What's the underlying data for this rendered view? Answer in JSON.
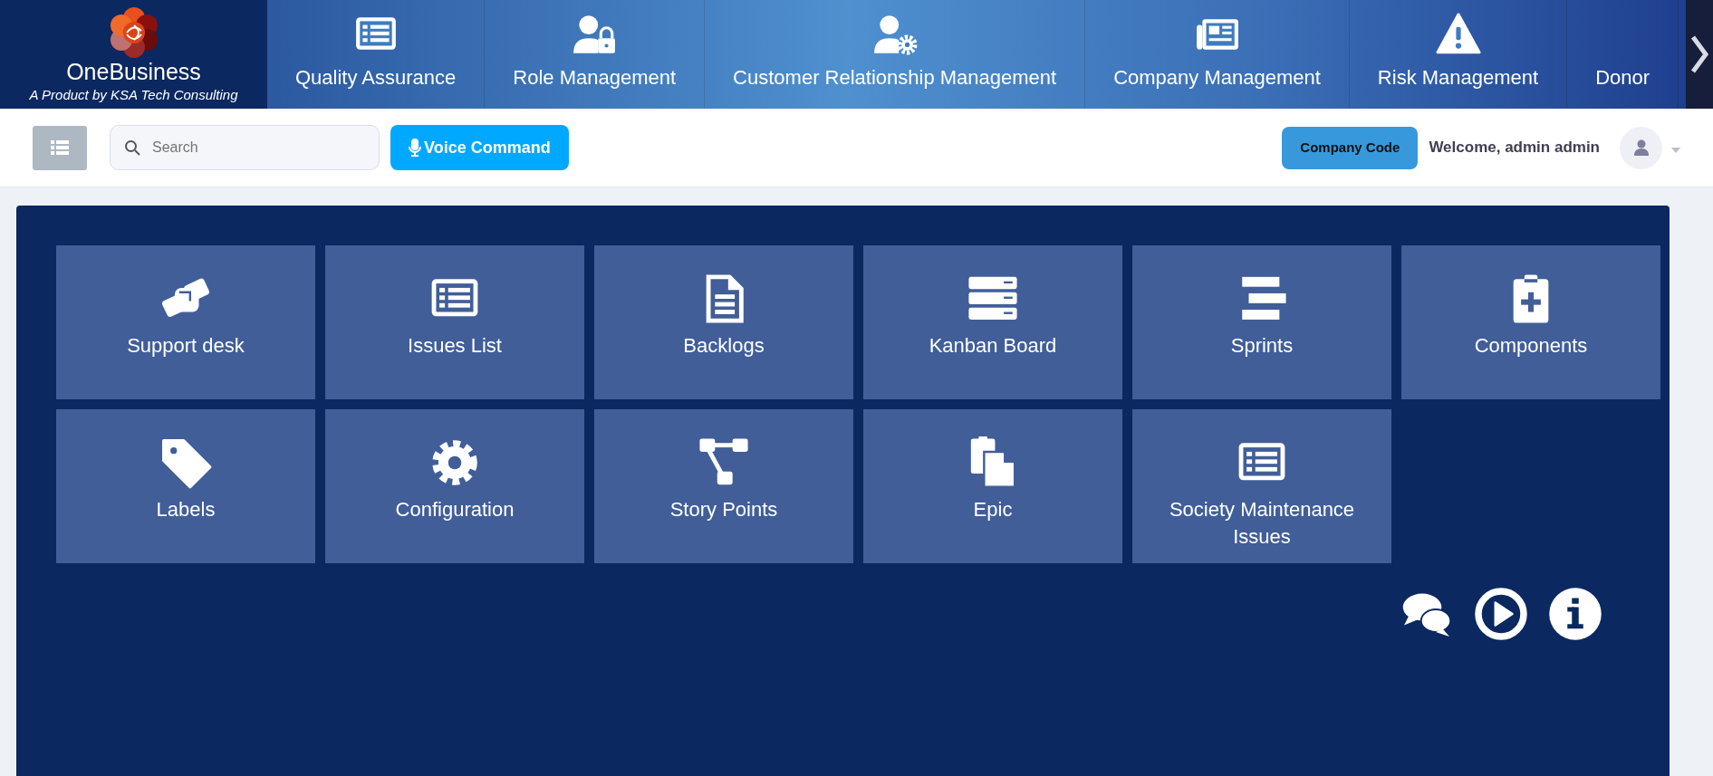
{
  "brand": {
    "name": "OneBusiness",
    "tagline": "A Product by KSA Tech Consulting"
  },
  "modules": [
    {
      "label": "Quality Assurance",
      "kind": "list"
    },
    {
      "label": "Role Management",
      "kind": "user-lock"
    },
    {
      "label": "Customer Relationship Management",
      "kind": "user-gear"
    },
    {
      "label": "Company Management",
      "kind": "newspaper"
    },
    {
      "label": "Risk Management",
      "kind": "warning"
    },
    {
      "label": "Donor",
      "kind": "plain"
    }
  ],
  "toolbar": {
    "search": {
      "placeholder": "Search"
    },
    "voice_button": "Voice Command",
    "company_button": "Company Code",
    "welcome": "Welcome, admin admin"
  },
  "tiles": [
    {
      "label": "Support desk",
      "kind": "handshake"
    },
    {
      "label": "Issues List",
      "kind": "list"
    },
    {
      "label": "Backlogs",
      "kind": "file"
    },
    {
      "label": "Kanban Board",
      "kind": "server"
    },
    {
      "label": "Sprints",
      "kind": "bars"
    },
    {
      "label": "Components",
      "kind": "clipboard"
    },
    {
      "label": "Labels",
      "kind": "tag"
    },
    {
      "label": "Configuration",
      "kind": "gear"
    },
    {
      "label": "Story Points",
      "kind": "sitemap"
    },
    {
      "label": "Epic",
      "kind": "copy"
    },
    {
      "label": "Society Maintenance Issues",
      "kind": "list"
    }
  ],
  "actions": [
    {
      "kind": "chat"
    },
    {
      "kind": "play"
    },
    {
      "kind": "info"
    }
  ]
}
